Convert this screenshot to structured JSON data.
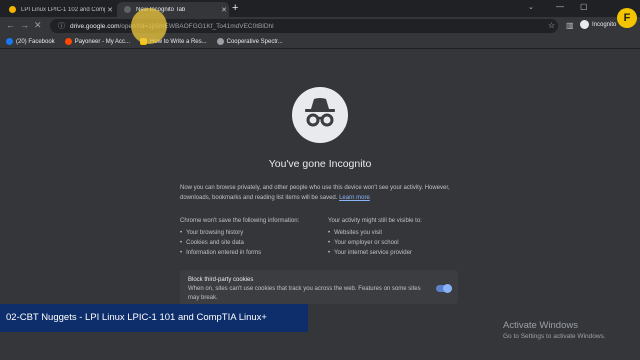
{
  "tabs": [
    {
      "title": "LPI Linux LPIC-1 102 and CompTIA",
      "favicon_color": "#f4b400",
      "active": false
    },
    {
      "title": "New Incognito Tab",
      "favicon_color": "#5f6368",
      "active": true
    }
  ],
  "toolbar": {
    "url_host": "drive.google.com",
    "url_path": "/open?id=1jiSmEWBAOFGG1Kf_To41mdVEC0tBlDhl",
    "profile_label": "Incognito"
  },
  "bookmarks": [
    {
      "label": "(20) Facebook",
      "color": "#1877f2"
    },
    {
      "label": "Payoneer - My Acc...",
      "color": "#ff4800"
    },
    {
      "label": "How to Write a Res...",
      "color": "#f5c400"
    },
    {
      "label": "Cooperative Spectr...",
      "color": "#9aa0a6"
    }
  ],
  "incognito": {
    "title": "You've gone Incognito",
    "intro": "Now you can browse privately, and other people who use this device won't see your activity. However, downloads, bookmarks and reading list items will be saved.",
    "learn_more": "Learn more",
    "not_saved_heading": "Chrome won't save the following information:",
    "not_saved": [
      "Your browsing history",
      "Cookies and site data",
      "Information entered in forms"
    ],
    "visible_heading": "Your activity might still be visible to:",
    "visible": [
      "Websites you visit",
      "Your employer or school",
      "Your internet service provider"
    ],
    "block_title": "Block third-party cookies",
    "block_desc": "When on, sites can't use cookies that track you across the web. Features on some sites may break.",
    "block_enabled": true
  },
  "overlay": {
    "course_title": "02-CBT Nuggets - LPI Linux LPIC-1 101 and CompTIA Linux+",
    "activate_title": "Activate Windows",
    "activate_sub": "Go to Settings to activate Windows.",
    "logo_letter": "F"
  }
}
